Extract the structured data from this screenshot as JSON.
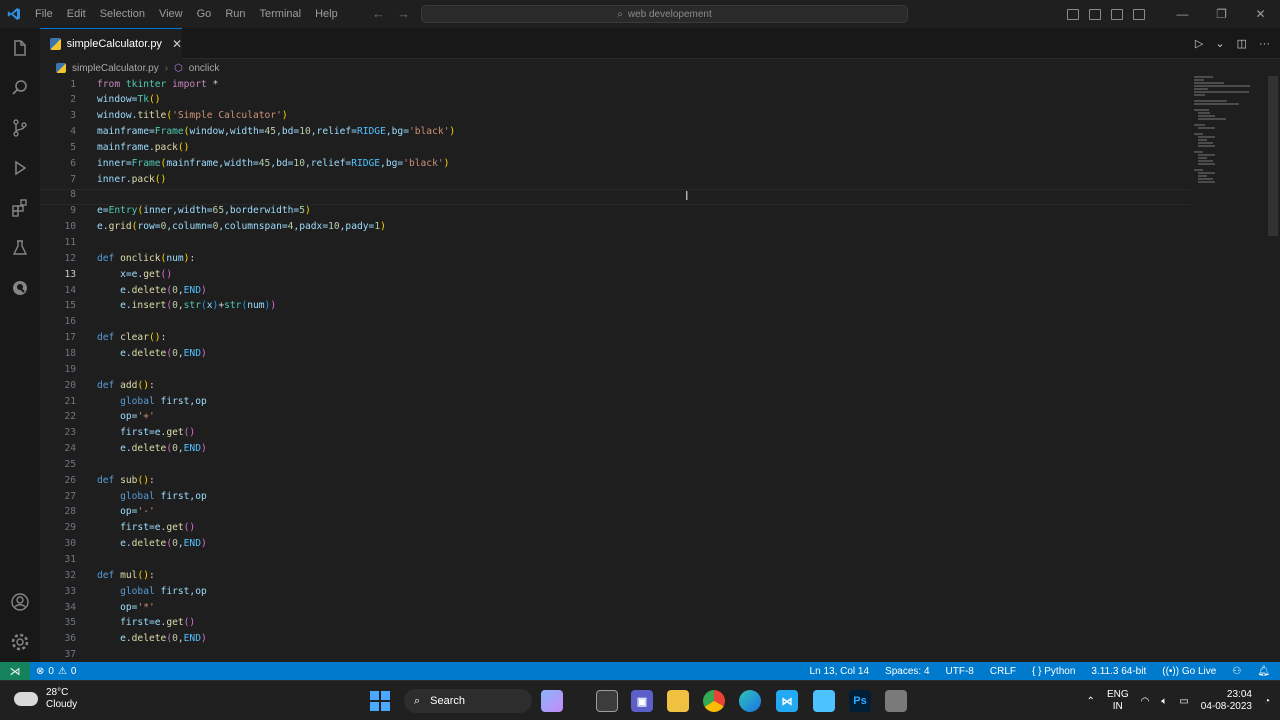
{
  "titlebar": {
    "menu": [
      "File",
      "Edit",
      "Selection",
      "View",
      "Go",
      "Run",
      "Terminal",
      "Help"
    ],
    "search_text": "web developement"
  },
  "tab": {
    "label": "simpleCalculator.py"
  },
  "breadcrumb": {
    "file": "simpleCalculator.py",
    "symbol": "onclick"
  },
  "editor": {
    "lines": [
      [
        {
          "t": "from ",
          "c": "#c586c0"
        },
        {
          "t": "tkinter ",
          "c": "#4ec9b0"
        },
        {
          "t": "import ",
          "c": "#c586c0"
        },
        {
          "t": "*",
          "c": "#d4d4d4"
        }
      ],
      [
        {
          "t": "window=",
          "c": "#9cdcfe"
        },
        {
          "t": "Tk",
          "c": "#4ec9b0"
        },
        {
          "t": "()",
          "c": "#ffd700"
        }
      ],
      [
        {
          "t": "window.",
          "c": "#9cdcfe"
        },
        {
          "t": "title",
          "c": "#dcdcaa"
        },
        {
          "t": "(",
          "c": "#ffd700"
        },
        {
          "t": "'Simple Calculator'",
          "c": "#ce9178"
        },
        {
          "t": ")",
          "c": "#ffd700"
        }
      ],
      [
        {
          "t": "mainframe=",
          "c": "#9cdcfe"
        },
        {
          "t": "Frame",
          "c": "#4ec9b0"
        },
        {
          "t": "(",
          "c": "#ffd700"
        },
        {
          "t": "window,width=",
          "c": "#9cdcfe"
        },
        {
          "t": "45",
          "c": "#b5cea8"
        },
        {
          "t": ",bd=",
          "c": "#9cdcfe"
        },
        {
          "t": "10",
          "c": "#b5cea8"
        },
        {
          "t": ",relief=",
          "c": "#9cdcfe"
        },
        {
          "t": "RIDGE",
          "c": "#4fc1ff"
        },
        {
          "t": ",bg=",
          "c": "#9cdcfe"
        },
        {
          "t": "'black'",
          "c": "#ce9178"
        },
        {
          "t": ")",
          "c": "#ffd700"
        }
      ],
      [
        {
          "t": "mainframe.",
          "c": "#9cdcfe"
        },
        {
          "t": "pack",
          "c": "#dcdcaa"
        },
        {
          "t": "()",
          "c": "#ffd700"
        }
      ],
      [
        {
          "t": "inner=",
          "c": "#9cdcfe"
        },
        {
          "t": "Frame",
          "c": "#4ec9b0"
        },
        {
          "t": "(",
          "c": "#ffd700"
        },
        {
          "t": "mainframe,width=",
          "c": "#9cdcfe"
        },
        {
          "t": "45",
          "c": "#b5cea8"
        },
        {
          "t": ",bd=",
          "c": "#9cdcfe"
        },
        {
          "t": "10",
          "c": "#b5cea8"
        },
        {
          "t": ",relief=",
          "c": "#9cdcfe"
        },
        {
          "t": "RIDGE",
          "c": "#4fc1ff"
        },
        {
          "t": ",bg=",
          "c": "#9cdcfe"
        },
        {
          "t": "'black'",
          "c": "#ce9178"
        },
        {
          "t": ")",
          "c": "#ffd700"
        }
      ],
      [
        {
          "t": "inner.",
          "c": "#9cdcfe"
        },
        {
          "t": "pack",
          "c": "#dcdcaa"
        },
        {
          "t": "()",
          "c": "#ffd700"
        }
      ],
      [],
      [
        {
          "t": "e=",
          "c": "#9cdcfe"
        },
        {
          "t": "Entry",
          "c": "#4ec9b0"
        },
        {
          "t": "(",
          "c": "#ffd700"
        },
        {
          "t": "inner,width=",
          "c": "#9cdcfe"
        },
        {
          "t": "65",
          "c": "#b5cea8"
        },
        {
          "t": ",borderwidth=",
          "c": "#9cdcfe"
        },
        {
          "t": "5",
          "c": "#b5cea8"
        },
        {
          "t": ")",
          "c": "#ffd700"
        }
      ],
      [
        {
          "t": "e.",
          "c": "#9cdcfe"
        },
        {
          "t": "grid",
          "c": "#dcdcaa"
        },
        {
          "t": "(",
          "c": "#ffd700"
        },
        {
          "t": "row=",
          "c": "#9cdcfe"
        },
        {
          "t": "0",
          "c": "#b5cea8"
        },
        {
          "t": ",column=",
          "c": "#9cdcfe"
        },
        {
          "t": "0",
          "c": "#b5cea8"
        },
        {
          "t": ",columnspan=",
          "c": "#9cdcfe"
        },
        {
          "t": "4",
          "c": "#b5cea8"
        },
        {
          "t": ",padx=",
          "c": "#9cdcfe"
        },
        {
          "t": "10",
          "c": "#b5cea8"
        },
        {
          "t": ",pady=",
          "c": "#9cdcfe"
        },
        {
          "t": "1",
          "c": "#b5cea8"
        },
        {
          "t": ")",
          "c": "#ffd700"
        }
      ],
      [],
      [
        {
          "t": "def ",
          "c": "#569cd6"
        },
        {
          "t": "onclick",
          "c": "#dcdcaa"
        },
        {
          "t": "(",
          "c": "#ffd700"
        },
        {
          "t": "num",
          "c": "#9cdcfe"
        },
        {
          "t": ")",
          "c": "#ffd700"
        },
        {
          "t": ":",
          "c": "#d4d4d4"
        }
      ],
      [
        {
          "t": "    x=e.",
          "c": "#9cdcfe"
        },
        {
          "t": "get",
          "c": "#dcdcaa"
        },
        {
          "t": "()",
          "c": "#da70d6"
        }
      ],
      [
        {
          "t": "    e.",
          "c": "#9cdcfe"
        },
        {
          "t": "delete",
          "c": "#dcdcaa"
        },
        {
          "t": "(",
          "c": "#da70d6"
        },
        {
          "t": "0",
          "c": "#b5cea8"
        },
        {
          "t": ",",
          "c": "#d4d4d4"
        },
        {
          "t": "END",
          "c": "#4fc1ff"
        },
        {
          "t": ")",
          "c": "#da70d6"
        }
      ],
      [
        {
          "t": "    e.",
          "c": "#9cdcfe"
        },
        {
          "t": "insert",
          "c": "#dcdcaa"
        },
        {
          "t": "(",
          "c": "#da70d6"
        },
        {
          "t": "0",
          "c": "#b5cea8"
        },
        {
          "t": ",",
          "c": "#d4d4d4"
        },
        {
          "t": "str",
          "c": "#4ec9b0"
        },
        {
          "t": "(",
          "c": "#179fff"
        },
        {
          "t": "x",
          "c": "#9cdcfe"
        },
        {
          "t": ")",
          "c": "#179fff"
        },
        {
          "t": "+",
          "c": "#d4d4d4"
        },
        {
          "t": "str",
          "c": "#4ec9b0"
        },
        {
          "t": "(",
          "c": "#179fff"
        },
        {
          "t": "num",
          "c": "#9cdcfe"
        },
        {
          "t": ")",
          "c": "#179fff"
        },
        {
          "t": ")",
          "c": "#da70d6"
        }
      ],
      [],
      [
        {
          "t": "def ",
          "c": "#569cd6"
        },
        {
          "t": "clear",
          "c": "#dcdcaa"
        },
        {
          "t": "()",
          "c": "#ffd700"
        },
        {
          "t": ":",
          "c": "#d4d4d4"
        }
      ],
      [
        {
          "t": "    e.",
          "c": "#9cdcfe"
        },
        {
          "t": "delete",
          "c": "#dcdcaa"
        },
        {
          "t": "(",
          "c": "#da70d6"
        },
        {
          "t": "0",
          "c": "#b5cea8"
        },
        {
          "t": ",",
          "c": "#d4d4d4"
        },
        {
          "t": "END",
          "c": "#4fc1ff"
        },
        {
          "t": ")",
          "c": "#da70d6"
        }
      ],
      [],
      [
        {
          "t": "def ",
          "c": "#569cd6"
        },
        {
          "t": "add",
          "c": "#dcdcaa"
        },
        {
          "t": "()",
          "c": "#ffd700"
        },
        {
          "t": ":",
          "c": "#d4d4d4"
        }
      ],
      [
        {
          "t": "    global ",
          "c": "#569cd6"
        },
        {
          "t": "first,op",
          "c": "#9cdcfe"
        }
      ],
      [
        {
          "t": "    op=",
          "c": "#9cdcfe"
        },
        {
          "t": "'+'",
          "c": "#ce9178"
        }
      ],
      [
        {
          "t": "    first=e.",
          "c": "#9cdcfe"
        },
        {
          "t": "get",
          "c": "#dcdcaa"
        },
        {
          "t": "()",
          "c": "#da70d6"
        }
      ],
      [
        {
          "t": "    e.",
          "c": "#9cdcfe"
        },
        {
          "t": "delete",
          "c": "#dcdcaa"
        },
        {
          "t": "(",
          "c": "#da70d6"
        },
        {
          "t": "0",
          "c": "#b5cea8"
        },
        {
          "t": ",",
          "c": "#d4d4d4"
        },
        {
          "t": "END",
          "c": "#4fc1ff"
        },
        {
          "t": ")",
          "c": "#da70d6"
        }
      ],
      [],
      [
        {
          "t": "def ",
          "c": "#569cd6"
        },
        {
          "t": "sub",
          "c": "#dcdcaa"
        },
        {
          "t": "()",
          "c": "#ffd700"
        },
        {
          "t": ":",
          "c": "#d4d4d4"
        }
      ],
      [
        {
          "t": "    global ",
          "c": "#569cd6"
        },
        {
          "t": "first,op",
          "c": "#9cdcfe"
        }
      ],
      [
        {
          "t": "    op=",
          "c": "#9cdcfe"
        },
        {
          "t": "'-'",
          "c": "#ce9178"
        }
      ],
      [
        {
          "t": "    first=e.",
          "c": "#9cdcfe"
        },
        {
          "t": "get",
          "c": "#dcdcaa"
        },
        {
          "t": "()",
          "c": "#da70d6"
        }
      ],
      [
        {
          "t": "    e.",
          "c": "#9cdcfe"
        },
        {
          "t": "delete",
          "c": "#dcdcaa"
        },
        {
          "t": "(",
          "c": "#da70d6"
        },
        {
          "t": "0",
          "c": "#b5cea8"
        },
        {
          "t": ",",
          "c": "#d4d4d4"
        },
        {
          "t": "END",
          "c": "#4fc1ff"
        },
        {
          "t": ")",
          "c": "#da70d6"
        }
      ],
      [],
      [
        {
          "t": "def ",
          "c": "#569cd6"
        },
        {
          "t": "mul",
          "c": "#dcdcaa"
        },
        {
          "t": "()",
          "c": "#ffd700"
        },
        {
          "t": ":",
          "c": "#d4d4d4"
        }
      ],
      [
        {
          "t": "    global ",
          "c": "#569cd6"
        },
        {
          "t": "first,op",
          "c": "#9cdcfe"
        }
      ],
      [
        {
          "t": "    op=",
          "c": "#9cdcfe"
        },
        {
          "t": "'*'",
          "c": "#ce9178"
        }
      ],
      [
        {
          "t": "    first=e.",
          "c": "#9cdcfe"
        },
        {
          "t": "get",
          "c": "#dcdcaa"
        },
        {
          "t": "()",
          "c": "#da70d6"
        }
      ],
      [
        {
          "t": "    e.",
          "c": "#9cdcfe"
        },
        {
          "t": "delete",
          "c": "#dcdcaa"
        },
        {
          "t": "(",
          "c": "#da70d6"
        },
        {
          "t": "0",
          "c": "#b5cea8"
        },
        {
          "t": ",",
          "c": "#d4d4d4"
        },
        {
          "t": "END",
          "c": "#4fc1ff"
        },
        {
          "t": ")",
          "c": "#da70d6"
        }
      ],
      []
    ],
    "active_line": 13
  },
  "statusbar": {
    "errors": "0",
    "warnings": "0",
    "position": "Ln 13, Col 14",
    "spaces": "Spaces: 4",
    "encoding": "UTF-8",
    "eol": "CRLF",
    "language": "Python",
    "interpreter": "3.11.3 64-bit",
    "golive": "Go Live"
  },
  "taskbar": {
    "temperature": "28°C",
    "weather": "Cloudy",
    "search_label": "Search",
    "lang_top": "ENG",
    "lang_bottom": "IN",
    "time": "23:04",
    "date": "04-08-2023"
  },
  "colors": {
    "statusbar": "#007acc",
    "accent": "#0078d4"
  }
}
